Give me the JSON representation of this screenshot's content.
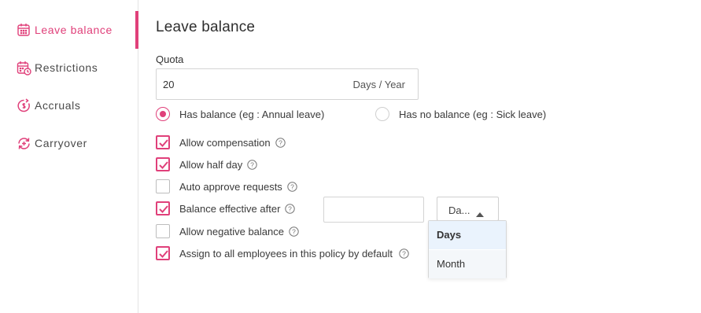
{
  "sidebar": {
    "items": [
      {
        "label": "Leave balance",
        "icon": "calendar-grid-icon",
        "active": true
      },
      {
        "label": "Restrictions",
        "icon": "calendar-clock-icon",
        "active": false
      },
      {
        "label": "Accruals",
        "icon": "accrual-cycle-icon",
        "active": false
      },
      {
        "label": "Carryover",
        "icon": "carryover-cycle-icon",
        "active": false
      }
    ]
  },
  "main": {
    "title": "Leave balance",
    "quota": {
      "label": "Quota",
      "value": "20",
      "unit": "Days / Year"
    },
    "balance_options": [
      {
        "label": "Has balance (eg : Annual leave)",
        "selected": true
      },
      {
        "label": "Has no balance (eg : Sick leave)",
        "selected": false
      }
    ],
    "options": [
      {
        "label": "Allow compensation",
        "checked": true
      },
      {
        "label": "Allow half day",
        "checked": true
      },
      {
        "label": "Auto approve requests",
        "checked": false
      },
      {
        "label": "Balance effective after",
        "checked": true
      },
      {
        "label": "Allow negative balance",
        "checked": false
      },
      {
        "label": "Assign to all employees in this policy by default",
        "checked": true
      }
    ],
    "effective_after": {
      "value": "",
      "unit_selected": "Da...",
      "unit_options": [
        "Days",
        "Month"
      ],
      "highlighted_option": "Days"
    }
  },
  "colors": {
    "accent": "#e0407a",
    "border": "#d4d4d4",
    "selected_option_bg": "#eaf3fd"
  }
}
